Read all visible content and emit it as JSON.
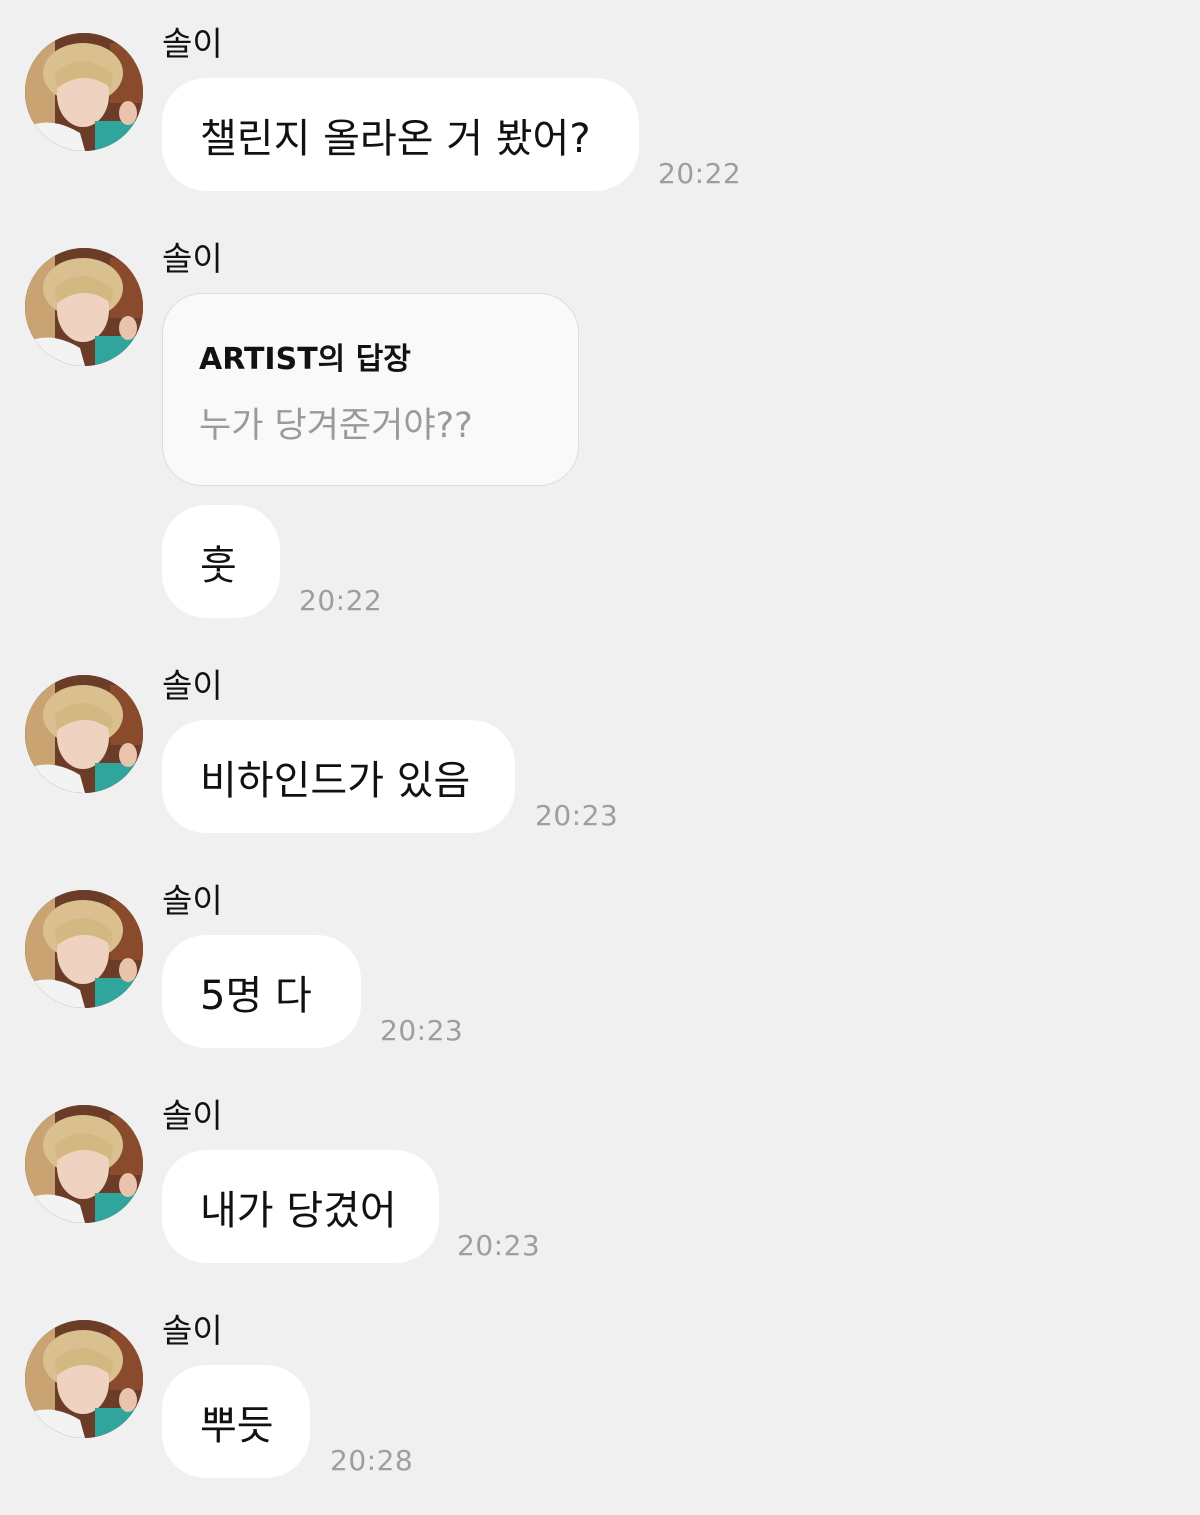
{
  "colors": {
    "background": "#f0f0f0",
    "bubble": "#ffffff",
    "timestamp": "#9e9e9e",
    "reply_card_bg": "#f9f9f9",
    "reply_card_border": "#dcdcdc"
  },
  "avatar": {
    "alt": "솔이 profile photo"
  },
  "messages": [
    {
      "sender": "솔이",
      "text": "챌린지 올라온 거 봤어?",
      "time": "20:22"
    },
    {
      "sender": "솔이",
      "reply": {
        "title": "ARTIST의 답장",
        "text": "누가 당겨준거야??"
      },
      "text": "훗",
      "time": "20:22"
    },
    {
      "sender": "솔이",
      "text": "비하인드가 있음",
      "time": "20:23"
    },
    {
      "sender": "솔이",
      "text": "5명 다",
      "time": "20:23"
    },
    {
      "sender": "솔이",
      "text": "내가 당겼어",
      "time": "20:23"
    },
    {
      "sender": "솔이",
      "text": "뿌듯",
      "time": "20:28"
    }
  ]
}
